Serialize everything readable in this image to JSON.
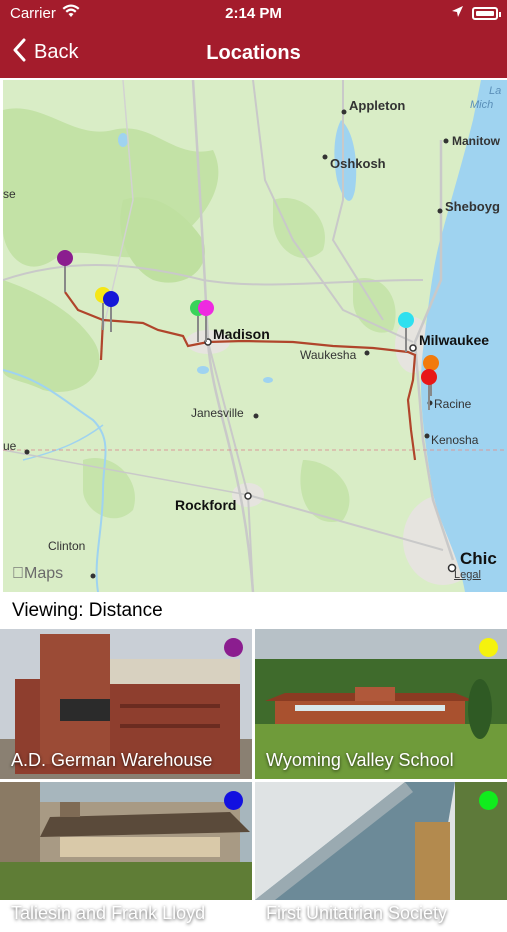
{
  "status_bar": {
    "carrier": "Carrier",
    "time": "2:14 PM"
  },
  "nav": {
    "back_label": "Back",
    "title": "Locations"
  },
  "map": {
    "cities": {
      "appleton": "Appleton",
      "oshkosh": "Oshkosh",
      "manitowoc": "Manitow",
      "sheboygan": "Sheboyg",
      "madison": "Madison",
      "milwaukee": "Milwaukee",
      "waukesha": "Waukesha",
      "racine": "Racine",
      "kenosha": "Kenosha",
      "janesville": "Janesville",
      "rockford": "Rockford",
      "chicago": "Chic",
      "clinton": "Clinton",
      "dubuque": "ue",
      "se_fragment": "se",
      "lake": "La",
      "lake2": "Mich"
    },
    "maps_logo": "Maps",
    "legal": "Legal",
    "pin_colors": [
      "#8b1d8f",
      "#f5e616",
      "#1518d8",
      "#39d35a",
      "#ee2be0",
      "#2ee0ef",
      "#f27a0c",
      "#e81717"
    ]
  },
  "viewing_label": "Viewing: Distance",
  "locations": [
    {
      "name": "A.D. German Warehouse",
      "color": "#8b1d8f"
    },
    {
      "name": "Wyoming Valley School",
      "color": "#f5f20d"
    },
    {
      "name": "Taliesin and Frank Lloyd",
      "color": "#1210e0"
    },
    {
      "name": "First Unitatrian Society",
      "color": "#10ec1d"
    }
  ]
}
